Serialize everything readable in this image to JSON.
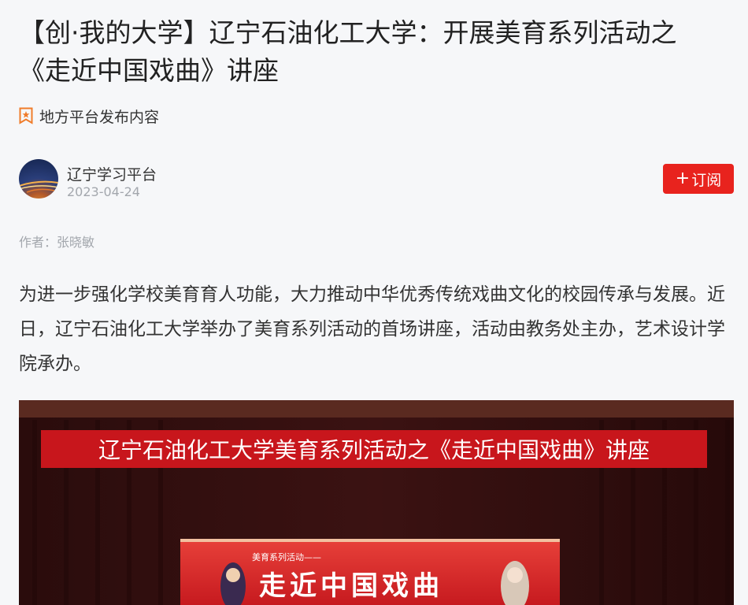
{
  "article": {
    "title": "【创·我的大学】辽宁石油化工大学：开展美育系列活动之《走近中国戏曲》讲座",
    "source_label": "地方平台发布内容",
    "channel_name": "辽宁学习平台",
    "publish_date": "2023-04-24",
    "subscribe_label": "订阅",
    "subscribe_icon": "plus-icon",
    "author_line": "作者：张晓敏",
    "body": "为进一步强化学校美育育人功能，大力推动中华优秀传统戏曲文化的校园传承与发展。近日，辽宁石油化工大学举办了美育系列活动的首场讲座，活动由教务处主办，艺术设计学院承办。"
  },
  "photo": {
    "banner_text": "辽宁石油化工大学美育系列活动之《走近中国戏曲》讲座",
    "screen_subtitle": "美育系列活动——",
    "screen_title": "走近中国戏曲"
  },
  "colors": {
    "accent": "#e8231e",
    "source_icon": "#f07c2a",
    "muted": "#a3a7ad"
  }
}
